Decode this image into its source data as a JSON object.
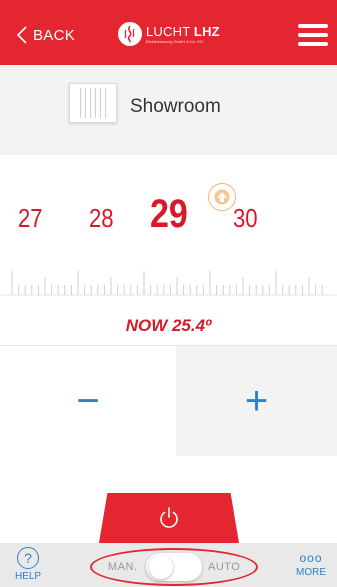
{
  "header": {
    "back_label": "BACK",
    "logo_text_prefix": "LUCHT ",
    "logo_text_bold": "LHZ",
    "logo_sub": "Elektroheizung GmbH & Co. KG"
  },
  "room": {
    "name": "Showroom",
    "icon": "radiator-icon"
  },
  "temperature": {
    "scale": [
      "27",
      "28",
      "29",
      "30"
    ],
    "selected": "29",
    "now_text": "NOW 25.4º",
    "up_badge_icon": "arrow-up-icon"
  },
  "controls": {
    "minus_label": "−",
    "plus_label": "+"
  },
  "bottom": {
    "help_symbol": "?",
    "help_label": "HELP",
    "more_symbol": "ooo",
    "more_label": "MORE",
    "man_label": "MAN.",
    "auto_label": "AUTO",
    "mode": "manual"
  },
  "colors": {
    "brand_red": "#e3262f",
    "accent_blue": "#2f7fc9",
    "temp_red": "#d7192a"
  }
}
